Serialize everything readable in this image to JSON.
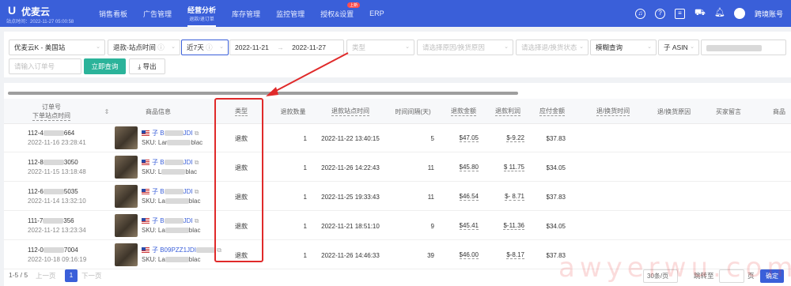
{
  "app": {
    "logo": "U",
    "name": "优麦云",
    "sub": "站点时间：2022-11-27 05:00:58",
    "account": "跨境账号"
  },
  "nav": {
    "items": [
      {
        "label": "销售看板"
      },
      {
        "label": "广告管理"
      },
      {
        "label": "经营分析",
        "sub": "退款/退订单"
      },
      {
        "label": "库存管理"
      },
      {
        "label": "监控管理"
      },
      {
        "label": "授权&设置",
        "badge": "上新"
      },
      {
        "label": "ERP"
      }
    ]
  },
  "filters": {
    "shop": "优麦云K - 美国站",
    "timeType": "退款-站点时间",
    "period": "近7天",
    "dateStart": "2022-11-21",
    "dateSep": "→",
    "dateEnd": "2022-11-27",
    "typePlaceholder": "类型",
    "reasonPlaceholder": "请选择原因/换货原因",
    "statusPlaceholder": "请选择退/换货状态",
    "matchMode": "模糊查询",
    "searchField": "子 ASIN",
    "orderPlaceholder": "请输入订单号",
    "queryButton": "立即查询",
    "exportButton": "导出"
  },
  "table": {
    "headers": {
      "order": "订单号",
      "orderSub": "下单站点时间",
      "product": "商品信息",
      "type": "类型",
      "qty": "退款数量",
      "refundTime": "退款站点时间",
      "interval": "时间间隔(天)",
      "refundAmount": "退款金额",
      "refundProfit": "退款利润",
      "paidAmount": "应付金额",
      "returnTime": "退/换货时间",
      "returnReason": "退/换货原因",
      "buyerNote": "买家留言",
      "more": "商品"
    },
    "rows": [
      {
        "orderStart": "112-4",
        "orderEnd": "664",
        "orderDate": "2022-11-16 23:28:41",
        "asin": "子 B",
        "asinEnd": "JDI",
        "skuStart": "SKU: Lar",
        "skuEnd": "blac",
        "type": "退款",
        "qty": "1",
        "refundTime": "2022-11-22 13:40:15",
        "interval": "5",
        "refundAmount": "$47.05",
        "refundProfit": "$-9.22",
        "paidAmount": "$37.83"
      },
      {
        "orderStart": "112-8",
        "orderEnd": "3050",
        "orderDate": "2022-11-15 13:18:48",
        "asin": "子 B",
        "asinEnd": "JDI",
        "skuStart": "SKU: L",
        "skuEnd": "blac",
        "type": "退款",
        "qty": "1",
        "refundTime": "2022-11-26 14:22:43",
        "interval": "11",
        "refundAmount": "$45.80",
        "refundProfit": "$ 11.75",
        "paidAmount": "$34.05"
      },
      {
        "orderStart": "112-6",
        "orderEnd": "5035",
        "orderDate": "2022-11-14 13:32:10",
        "asin": "子 B",
        "asinEnd": "JDI",
        "skuStart": "SKU: La",
        "skuEnd": "blac",
        "type": "退款",
        "qty": "1",
        "refundTime": "2022-11-25 19:33:43",
        "interval": "11",
        "refundAmount": "$46.54",
        "refundProfit": "$- 8.71",
        "paidAmount": "$37.83"
      },
      {
        "orderStart": "111-7",
        "orderEnd": "356",
        "orderDate": "2022-11-12 13:23:34",
        "asin": "子 B",
        "asinEnd": "JDI",
        "skuStart": "SKU: La",
        "skuEnd": "blac",
        "type": "退款",
        "qty": "1",
        "refundTime": "2022-11-21 18:51:10",
        "interval": "9",
        "refundAmount": "$45.41",
        "refundProfit": "$-11.36",
        "paidAmount": "$34.05"
      },
      {
        "orderStart": "112-0",
        "orderEnd": "7004",
        "orderDate": "2022-10-18 09:16:19",
        "asin": "子 B09PZZ1JDI",
        "asinEnd": "",
        "skuStart": "SKU: La",
        "skuEnd": "blac",
        "type": "退款",
        "qty": "1",
        "refundTime": "2022-11-26 14:46:33",
        "interval": "39",
        "refundAmount": "$46.00",
        "refundProfit": "$-8.17",
        "paidAmount": "$37.83"
      }
    ]
  },
  "pager": {
    "summary": "1-5 / 5",
    "prev": "上一页",
    "page": "1",
    "next": "下一页",
    "pageSize": "30条/页",
    "jumpLabel": "跳转至",
    "pageUnit": "页",
    "confirm": "确定"
  },
  "watermark": "awyerwu.com",
  "colors": {
    "primary": "#3a5fd9",
    "query": "#2bb39a",
    "highlight": "#e02a2a"
  }
}
